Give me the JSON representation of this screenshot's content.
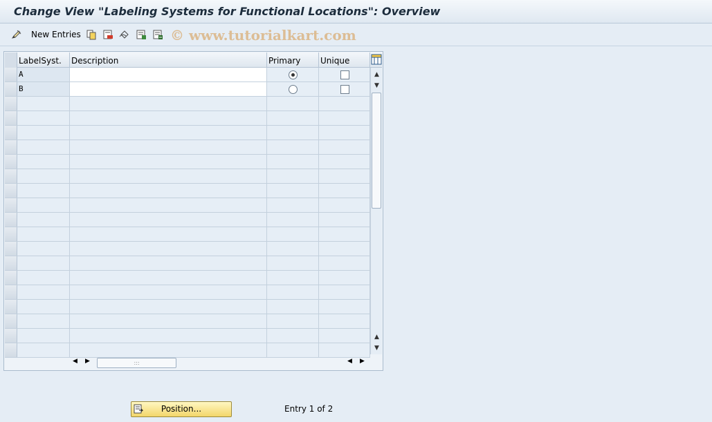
{
  "window": {
    "title": "Change View \"Labeling Systems for Functional Locations\": Overview"
  },
  "toolbar": {
    "new_entries_label": "New Entries",
    "watermark": "© www.tutorialkart.com"
  },
  "table": {
    "columns": [
      "LabelSyst.",
      "Description",
      "Primary",
      "Unique"
    ],
    "rows": [
      {
        "labelsyst": "A",
        "description": "",
        "primary": true,
        "unique": false
      },
      {
        "labelsyst": "B",
        "description": "",
        "primary": false,
        "unique": false
      }
    ]
  },
  "footer": {
    "position_button_label": "Position...",
    "entry_info": "Entry 1 of 2"
  },
  "icons": {
    "toolbar": [
      "edit-pen-icon",
      "copy-icon",
      "delete-icon",
      "undo-icon",
      "select-all-icon",
      "deselect-icon"
    ],
    "table_settings": "table-settings-icon"
  }
}
